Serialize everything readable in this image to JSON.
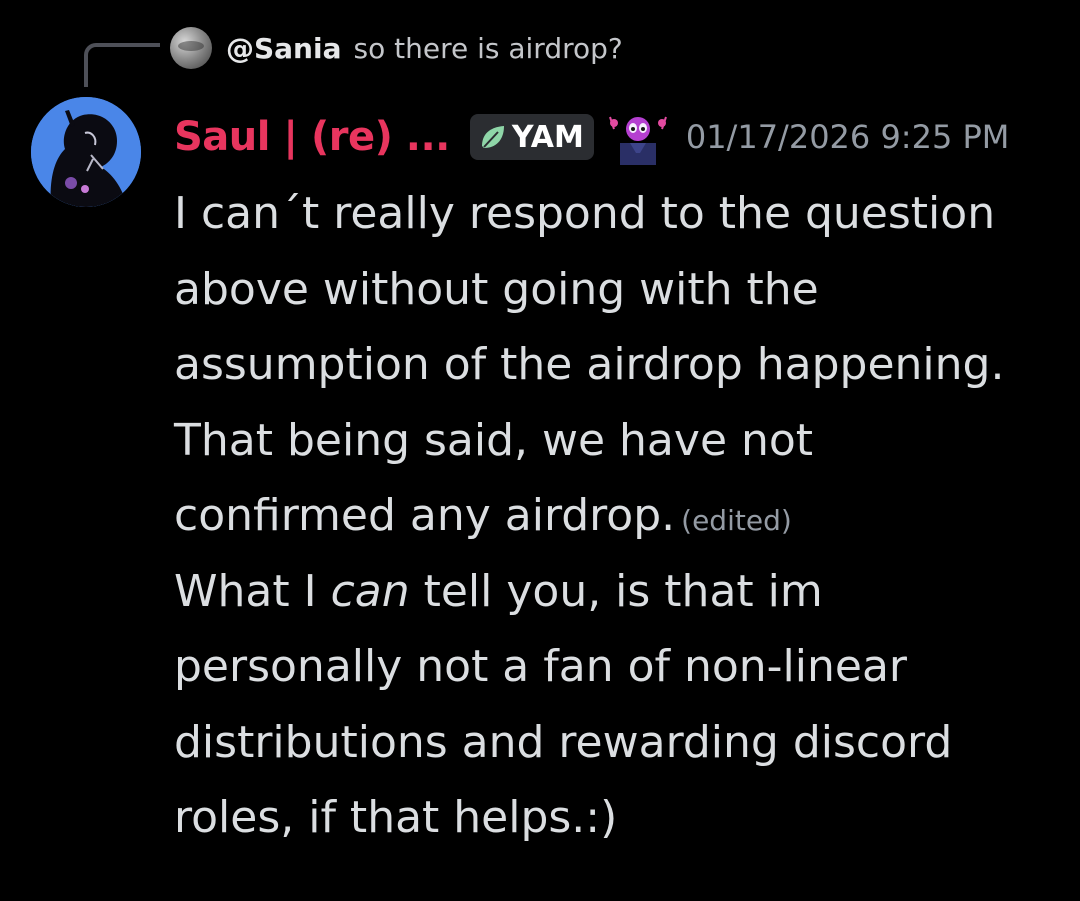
{
  "reply": {
    "mention": "@Sania",
    "text": "so there is airdrop?"
  },
  "author": {
    "name": "Saul | (re) ...",
    "tag_label": "YAM",
    "tag_icon": "leaf-icon",
    "role_icon": "alien-character-icon",
    "name_color": "#e8355e"
  },
  "timestamp": "01/17/2026 9:25 PM",
  "message": {
    "paragraph1": {
      "lines": [
        "I can´t really respond to the question",
        "above without going with the",
        "assumption of the airdrop happening.",
        "That being said, we have not",
        "confirmed any airdrop."
      ],
      "edited_label": "(edited)"
    },
    "paragraph2": {
      "line1_before": "What I ",
      "line1_emphasis": "can",
      "line1_after": " tell you, is that im",
      "lines": [
        "personally not a fan of non-linear",
        "distributions and rewarding discord",
        "roles, if that helps.:)"
      ]
    }
  },
  "colors": {
    "background": "#000000",
    "text": "#dbdee1",
    "muted": "#949ba4",
    "tag_background": "#2b2d31"
  }
}
